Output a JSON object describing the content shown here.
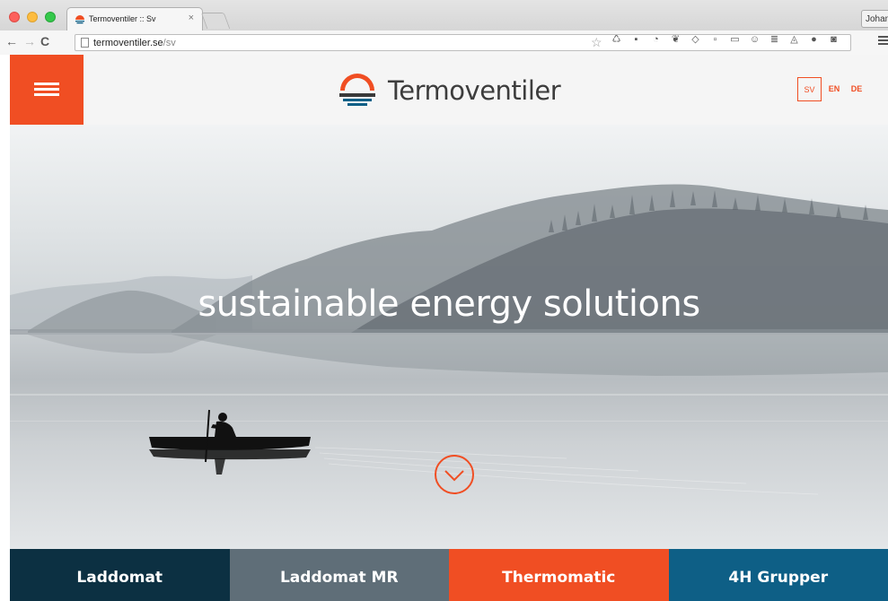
{
  "browser": {
    "tab_title": "Termoventiler :: Sv",
    "tab_close": "×",
    "url_host": "termoventiler.se",
    "url_path": "/sv",
    "profile_name": "Johan"
  },
  "site": {
    "logo_text": "Termoventiler",
    "brand_color": "#f04e23",
    "languages": {
      "sv": "SV",
      "en": "EN",
      "de": "DE"
    },
    "tagline": "sustainable energy solutions",
    "products": [
      {
        "label": "Laddomat",
        "color": "#0c3042"
      },
      {
        "label": "Laddomat MR",
        "color": "#5f6e78"
      },
      {
        "label": "Thermomatic",
        "color": "#f04e23"
      },
      {
        "label": "4H Grupper",
        "color": "#0e5f86"
      }
    ]
  }
}
